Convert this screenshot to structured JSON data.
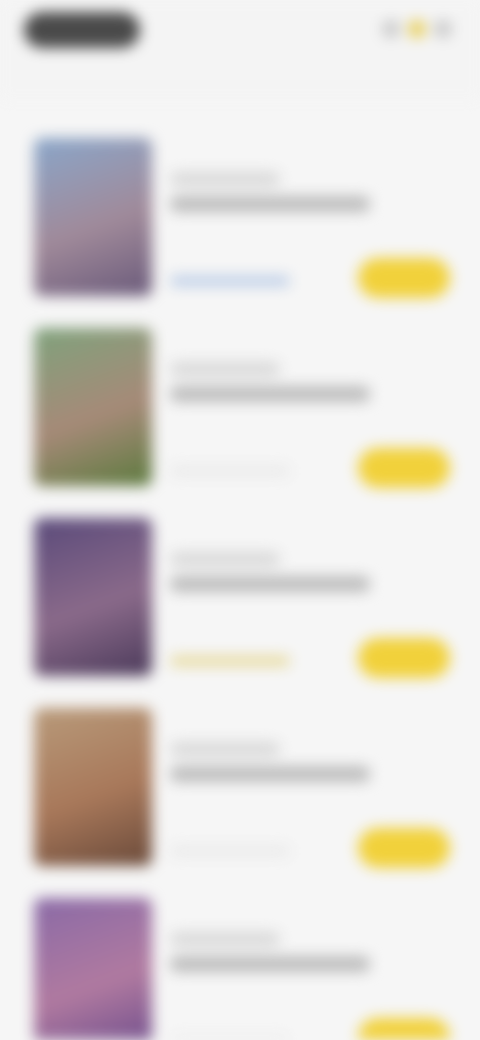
{
  "header": {
    "icons": [
      "menu-icon",
      "search-icon",
      "profile-icon"
    ],
    "accent_color": "#f1d13b",
    "pill_color": "#4a4a4a"
  },
  "items": [
    {
      "cover_gradient": [
        "#8aa6c9",
        "#a08a9a",
        "#6a5a7a"
      ],
      "subtitle": "",
      "title": "",
      "tag_color": "#b9cbe6",
      "action_label": ""
    },
    {
      "cover_gradient": [
        "#7fa27c",
        "#a68a78",
        "#5c7a3e"
      ],
      "subtitle": "",
      "title": "",
      "tag_color": "#e9e9e9",
      "action_label": ""
    },
    {
      "cover_gradient": [
        "#5a4a7a",
        "#8a6a8a",
        "#4b3a5a"
      ],
      "subtitle": "",
      "title": "",
      "tag_color": "#e6d99a",
      "action_label": ""
    },
    {
      "cover_gradient": [
        "#b89a7a",
        "#a8785a",
        "#6a4a3a"
      ],
      "subtitle": "",
      "title": "",
      "tag_color": "#e9e9e9",
      "action_label": ""
    },
    {
      "cover_gradient": [
        "#8a6aa6",
        "#b07aa0",
        "#6a4a8a"
      ],
      "subtitle": "",
      "title": "",
      "tag_color": "#e9e9e9",
      "action_label": ""
    }
  ]
}
